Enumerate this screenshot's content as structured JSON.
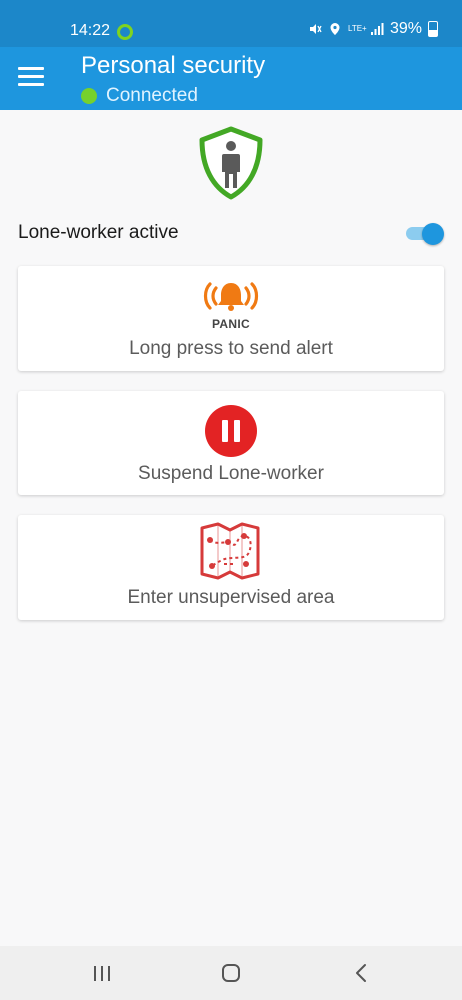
{
  "status_bar": {
    "time": "14:22",
    "network": "LTE+",
    "battery": "39%"
  },
  "header": {
    "title": "Personal security",
    "connection_status": "Connected"
  },
  "lone_worker": {
    "label": "Lone-worker active",
    "enabled": true
  },
  "cards": {
    "panic": {
      "badge": "PANIC",
      "label": "Long press to send alert"
    },
    "suspend": {
      "label": "Suspend Lone-worker"
    },
    "unsupervised": {
      "label": "Enter unsupervised area"
    }
  },
  "colors": {
    "status_bar": "#1c87c9",
    "app_bar": "#1e96de",
    "connected": "#76d12d",
    "shield": "#43a825",
    "panic": "#f07a13",
    "suspend": "#e32324",
    "map": "#d63a3a"
  },
  "icons": [
    "menu-icon",
    "shield-person-icon",
    "panic-bell-icon",
    "pause-icon",
    "map-route-icon"
  ]
}
